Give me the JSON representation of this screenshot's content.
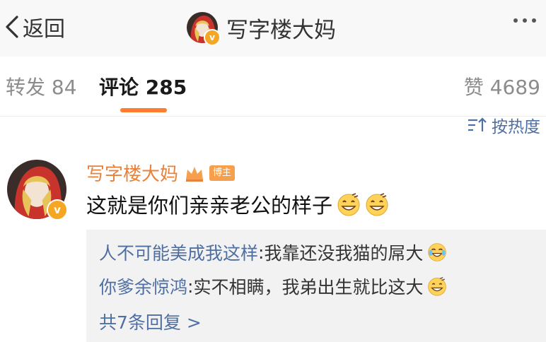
{
  "navbar": {
    "back_label": "返回",
    "title": "写字楼大妈",
    "verified_badge": "v",
    "back_icon": "chevron-left-icon",
    "more_icon": "ellipsis-icon"
  },
  "tabs": {
    "repost": "转发 84",
    "comment": "评论 285",
    "like": "赞 4689",
    "active_color": "#ff7b2e"
  },
  "sort": {
    "label": "按热度",
    "icon": "sort-icon"
  },
  "comment": {
    "author": "写字楼大妈",
    "author_badge": "博主",
    "verified_badge": "v",
    "text": "这就是你们亲亲老公的样子",
    "emojis": [
      "grin-emoji",
      "grin-emoji"
    ],
    "name_color": "#e8823b"
  },
  "replies": {
    "items": [
      {
        "user": "人不可能美成我这样",
        "separator": ": ",
        "text": "我靠还没我猫的屌大",
        "emoji": "laugh-cry-emoji"
      },
      {
        "user": "你爹余惊鸿",
        "separator": ": ",
        "text": "实不相瞒，我弟出生就比这大",
        "emoji": "grin-emoji"
      }
    ],
    "more_label": "共7条回复 >",
    "link_color": "#4f6fa3"
  }
}
